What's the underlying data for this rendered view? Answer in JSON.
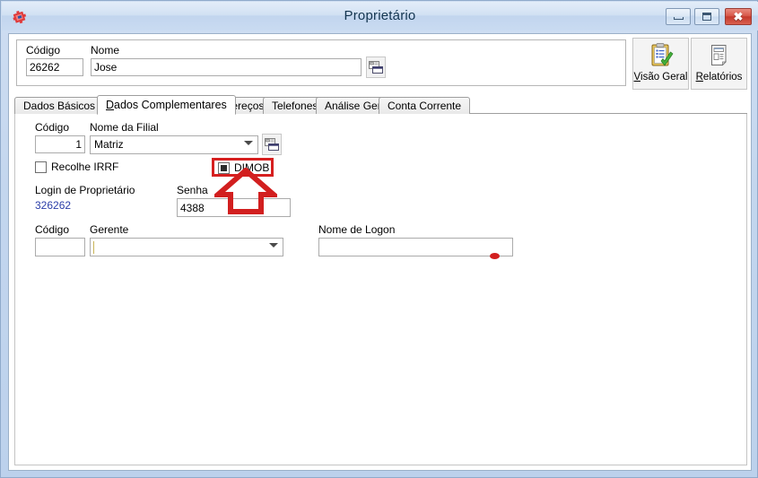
{
  "window": {
    "title": "Proprietário",
    "icon": "app-diamond-icon",
    "controls": {
      "minimize": "minimize-icon",
      "maximize": "maximize-icon",
      "close": "close-icon"
    }
  },
  "header": {
    "codigo_label": "Código",
    "codigo_value": "26262",
    "nome_label": "Nome",
    "nome_value": "Jose",
    "nome_browse_icon": "form-window-icon"
  },
  "toolbar": {
    "buttons": [
      {
        "label_prefix": "V",
        "label_rest": "isão Geral",
        "icon": "clipboard-check-icon"
      },
      {
        "label_prefix": "R",
        "label_rest": "elatórios",
        "icon": "report-document-icon"
      }
    ]
  },
  "tabs": [
    {
      "label": "Dados Básicos",
      "active": false
    },
    {
      "label_prefix": "D",
      "label_rest": "ados Complementares",
      "active": true
    },
    {
      "label_prefix": "E",
      "label_rest": "ndereços",
      "active": false
    },
    {
      "label": "Telefones",
      "active": false
    },
    {
      "label": "Análise Geral",
      "active": false
    },
    {
      "label": "Conta Corrente",
      "active": false
    }
  ],
  "form": {
    "filial_codigo_label": "Código",
    "filial_codigo_value": "1",
    "filial_nome_label": "Nome da Filial",
    "filial_nome_value": "Matriz",
    "filial_browse_icon": "form-window-icon",
    "recolhe_irrf_label": "Recolhe IRRF",
    "recolhe_irrf_checked": false,
    "dimob_label": "DIMOB",
    "dimob_checked": true,
    "login_label": "Login de Proprietário",
    "login_value": "326262",
    "senha_label": "Senha",
    "senha_value": "4388",
    "gerente_codigo_label": "Código",
    "gerente_codigo_value": "",
    "gerente_label": "Gerente",
    "gerente_value": "",
    "nome_logon_label": "Nome de Logon",
    "nome_logon_value": ""
  },
  "annotations": {
    "highlight_color": "#d61f1f",
    "arrow_color": "#d61f1f",
    "arrow_direction": "up",
    "arrow_target": "dimob-checkbox"
  },
  "colors": {
    "title_bar_accent": "#c2d5ee",
    "close_button": "#c4392c",
    "login_link": "#2b3ea8",
    "annotation_red": "#d61f1f",
    "window_background": "#d6e3f4"
  }
}
